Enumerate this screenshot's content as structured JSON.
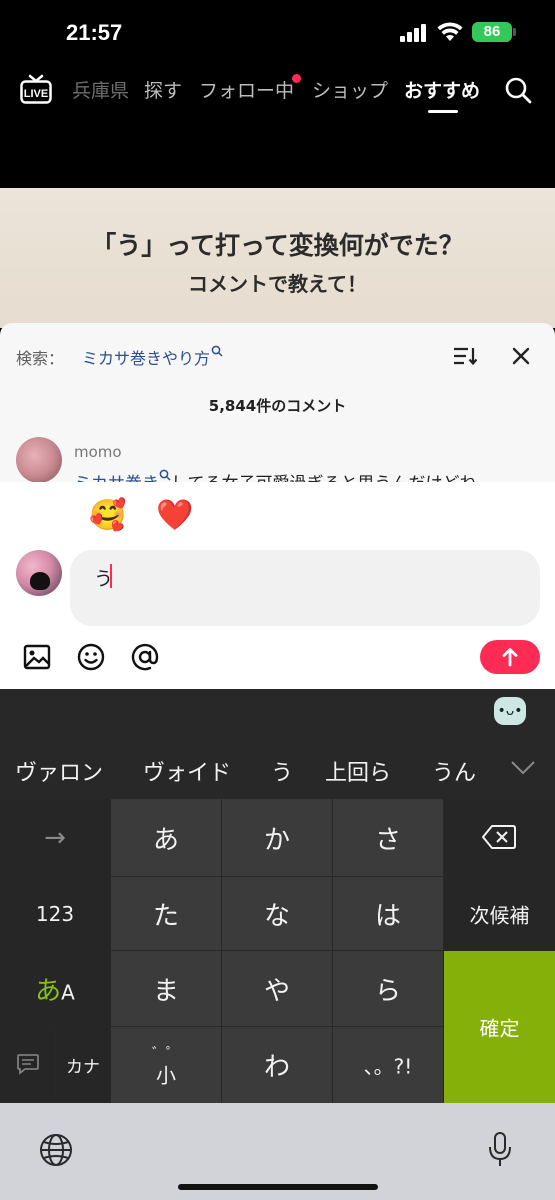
{
  "status_bar": {
    "time": "21:57",
    "battery": "86"
  },
  "nav": {
    "live_label": "LIVE",
    "tabs": [
      {
        "label": "兵庫県"
      },
      {
        "label": "探す"
      },
      {
        "label": "フォロー中"
      },
      {
        "label": "ショップ"
      },
      {
        "label": "おすすめ"
      }
    ],
    "active_tab": "おすすめ",
    "accent_color": "#fe2c55"
  },
  "video": {
    "line1": "「う」って打って変換何がでた？",
    "line2": "コメントで教えて！"
  },
  "comments": {
    "search_label": "検索：",
    "search_term": "ミカサ巻きやり方",
    "count_text": "5,844件のコメント",
    "first": {
      "username": "momo",
      "text_link": "ミカサ巻き",
      "text_rest": "してる女子可愛過ぎると思うんだけどね"
    }
  },
  "composer": {
    "emojis": [
      "😭",
      "🥰",
      "❤️",
      "😁",
      "😂",
      "😳",
      "😏",
      "😅"
    ],
    "input_value": "う"
  },
  "keyboard": {
    "badge": "•ᴗ•",
    "candidates": [
      "ヴァロン",
      "ヴォイド",
      "う",
      "上回ら",
      "うん"
    ],
    "keys": {
      "arrow": "→",
      "a": "あ",
      "ka": "か",
      "sa": "さ",
      "num": "123",
      "ta": "た",
      "na": "な",
      "ha": "は",
      "next": "次候補",
      "mode_a": "あ",
      "mode_A": "A",
      "ma": "ま",
      "ya": "や",
      "ra": "ら",
      "confirm": "確定",
      "kana": "カナ",
      "dakuten": "゛゜",
      "dakuten_sub": "小",
      "wa": "わ",
      "punct": "、。?!"
    }
  }
}
